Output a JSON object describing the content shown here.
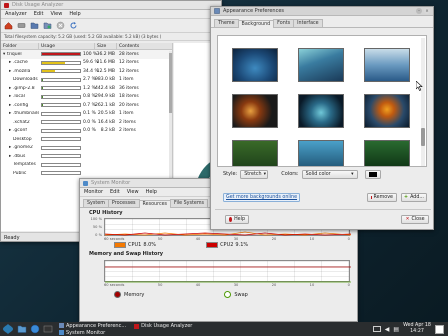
{
  "disk_analyzer": {
    "title": "Disk Usage Analyzer",
    "menu": [
      "Analyzer",
      "Edit",
      "View",
      "Help"
    ],
    "capacity_text": "Total filesystem capacity: 5.2 GB (used: 5.2 GB available: 5.2 kB) (3 bytes )",
    "columns": [
      "Folder",
      "Usage",
      "Size",
      "Contents"
    ],
    "rows": [
      {
        "name": "triquel",
        "pct": "100 %",
        "size": "36.2 MB",
        "contents": "28 items",
        "fill": 100,
        "color": "#c0171b",
        "arrow": "▾"
      },
      {
        "name": ".cache",
        "pct": "59.6 %",
        "size": "21.6 MB",
        "contents": "12 items",
        "fill": 60,
        "color": "#e2c21a",
        "arrow": "▸"
      },
      {
        "name": ".mozilla",
        "pct": "34.4 %",
        "size": "12.5 MB",
        "contents": "12 items",
        "fill": 34,
        "color": "#e2c21a",
        "arrow": "▸"
      },
      {
        "name": "Downloads",
        "pct": "2.7 %",
        "size": "983.0 kB",
        "contents": "1 item",
        "fill": 3,
        "color": "#4a8a2a",
        "arrow": ""
      },
      {
        "name": ".gimp-2.8",
        "pct": "1.2 %",
        "size": "442.4 kB",
        "contents": "36 items",
        "fill": 1,
        "color": "#4a8a2a",
        "arrow": "▸"
      },
      {
        "name": ".local",
        "pct": "0.8 %",
        "size": "294.9 kB",
        "contents": "18 items",
        "fill": 1,
        "color": "#4a8a2a",
        "arrow": "▸"
      },
      {
        "name": ".config",
        "pct": "0.7 %",
        "size": "262.1 kB",
        "contents": "20 items",
        "fill": 1,
        "color": "#4a8a2a",
        "arrow": "▸"
      },
      {
        "name": ".thumbnails",
        "pct": "0.1 %",
        "size": "20.5 kB",
        "contents": "1 item",
        "fill": 0,
        "color": "#4a8a2a",
        "arrow": "▸"
      },
      {
        "name": ".xchat2",
        "pct": "0.0 %",
        "size": "16.4 kB",
        "contents": "2 items",
        "fill": 0,
        "color": "#4a8a2a",
        "arrow": ""
      },
      {
        "name": ".gconf",
        "pct": "0.0 %",
        "size": "8.2 kB",
        "contents": "2 items",
        "fill": 0,
        "color": "#4a8a2a",
        "arrow": "▸"
      },
      {
        "name": "Desktop",
        "pct": "",
        "size": "",
        "contents": "",
        "fill": 0,
        "color": "#4a8a2a",
        "arrow": ""
      },
      {
        "name": ".gnome2",
        "pct": "",
        "size": "",
        "contents": "",
        "fill": 0,
        "color": "#4a8a2a",
        "arrow": "▸"
      },
      {
        "name": ".dbus",
        "pct": "",
        "size": "",
        "contents": "",
        "fill": 0,
        "color": "#4a8a2a",
        "arrow": "▸"
      },
      {
        "name": "Templates",
        "pct": "",
        "size": "",
        "contents": "",
        "fill": 0,
        "color": "#4a8a2a",
        "arrow": ""
      },
      {
        "name": "Public",
        "pct": "",
        "size": "",
        "contents": "",
        "fill": 0,
        "color": "#4a8a2a",
        "arrow": ""
      }
    ],
    "status": "Ready"
  },
  "sys_monitor": {
    "title": "System Monitor",
    "menu": [
      "Monitor",
      "Edit",
      "View",
      "Help"
    ],
    "tabs": [
      "System",
      "Processes",
      "Resources",
      "File Systems"
    ],
    "active_tab": "Resources",
    "cpu_header": "CPU History",
    "cpu_legend": [
      {
        "label": "CPU1",
        "value": "8.0%",
        "color": "#f57900"
      },
      {
        "label": "CPU2",
        "value": "9.1%",
        "color": "#cc0000"
      }
    ],
    "mem_header": "Memory and Swap History",
    "axis_left": "60 seconds",
    "axis_ticks": [
      "50",
      "40",
      "30",
      "20",
      "10",
      "0"
    ],
    "mem_label": "Memory",
    "swap_label": "Swap",
    "mem_color": "#a40000",
    "swap_color": "#4e9a06",
    "pct_ticks_cpu": [
      "100 %",
      "50 %",
      "0 %"
    ]
  },
  "appearance": {
    "title": "Appearance Preferences",
    "tabs": [
      "Theme",
      "Background",
      "Fonts",
      "Interface"
    ],
    "active_tab": "Background",
    "style_label": "Style:",
    "style_value": "Stretch",
    "colors_label": "Colors:",
    "colors_value": "Solid color",
    "more_link": "Get more backgrounds online",
    "remove_label": "Remove",
    "add_label": "Add...",
    "help_label": "Help",
    "close_label": "Close"
  },
  "taskbar": {
    "items": [
      {
        "label": "Appearance Preferenc...",
        "icon": "appearance-icon"
      },
      {
        "label": "Disk Usage Analyzer",
        "icon": "disk-analyzer-icon"
      },
      {
        "label": "System Monitor",
        "icon": "system-monitor-icon"
      }
    ],
    "clock_date": "Wed Apr 18",
    "clock_time": "14:27"
  }
}
